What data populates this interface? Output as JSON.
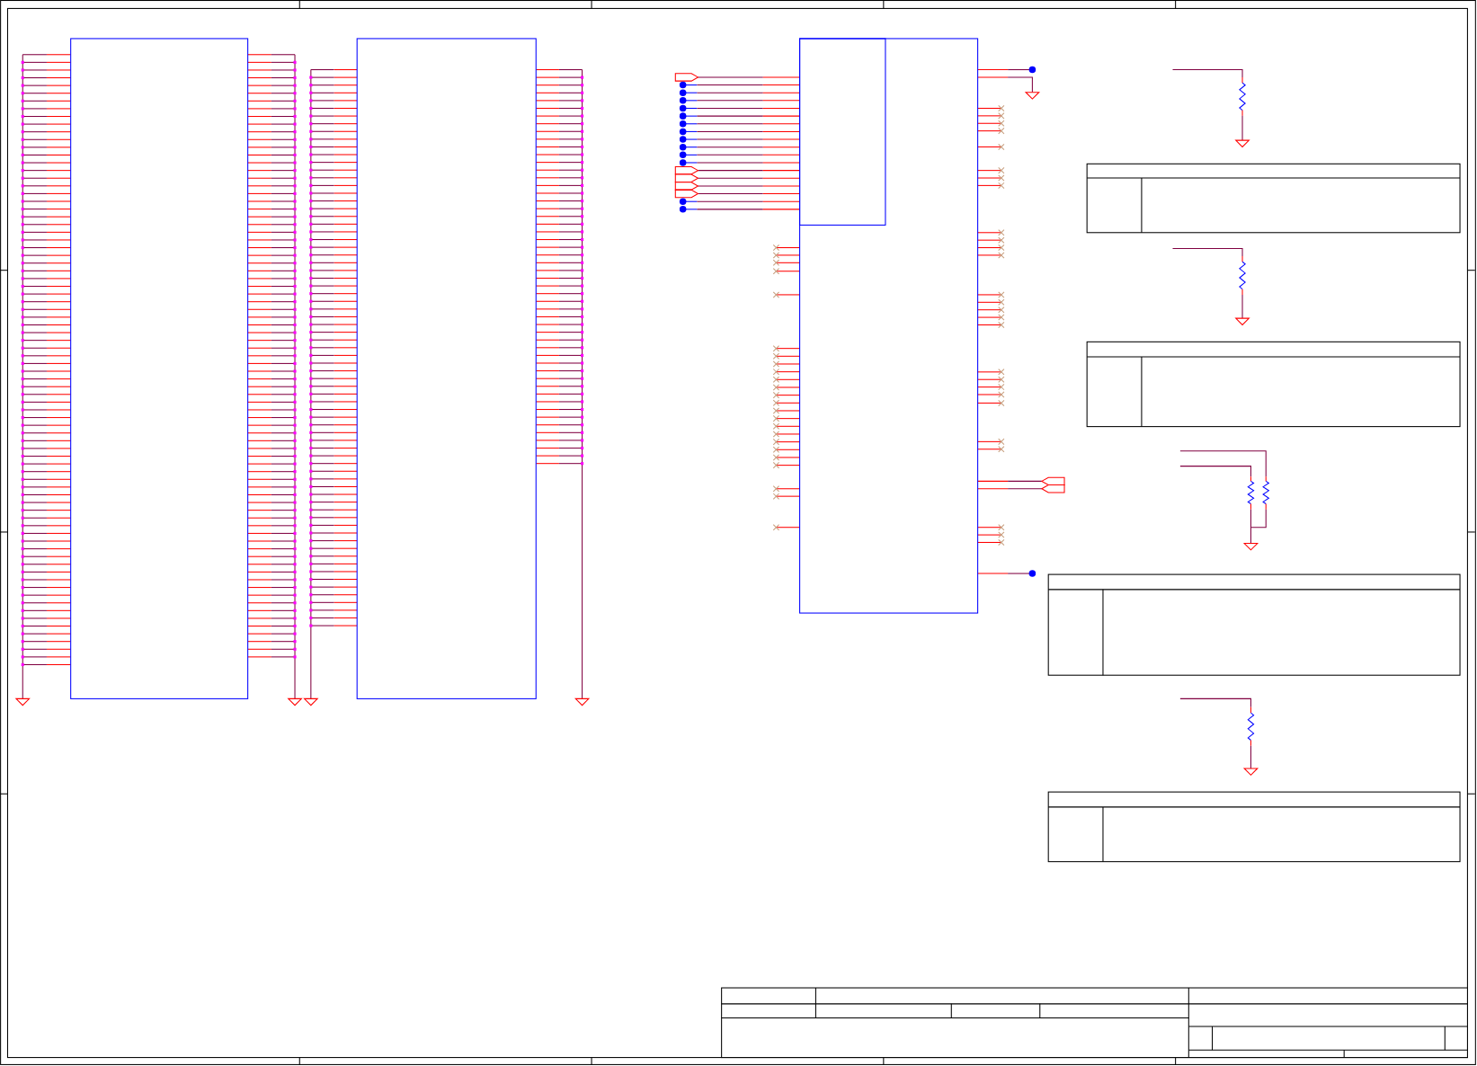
{
  "sheet": {
    "kind": "schematic"
  },
  "connectors": [
    {
      "kind": "header"
    },
    {
      "kind": "header"
    }
  ],
  "chip": {
    "left_pins": [
      {
        "kind": "port"
      },
      {
        "kind": "dot"
      },
      {
        "kind": "dot"
      },
      {
        "kind": "dot"
      },
      {
        "kind": "dot"
      },
      {
        "kind": "dot"
      },
      {
        "kind": "dot"
      },
      {
        "kind": "dot"
      },
      {
        "kind": "dot"
      },
      {
        "kind": "dot"
      },
      {
        "kind": "dot"
      },
      {
        "kind": "dot"
      },
      {
        "kind": "port"
      },
      {
        "kind": "port"
      },
      {
        "kind": "port"
      },
      {
        "kind": "port"
      },
      {
        "kind": "dot"
      },
      {
        "kind": "dot"
      },
      {
        "kind": "open"
      },
      {
        "kind": "open"
      },
      {
        "kind": "open"
      },
      {
        "kind": "open"
      },
      {
        "kind": "open"
      },
      {
        "kind": "open"
      },
      {
        "kind": "open"
      },
      {
        "kind": "open"
      },
      {
        "kind": "open"
      },
      {
        "kind": "open"
      },
      {
        "kind": "open"
      },
      {
        "kind": "open"
      },
      {
        "kind": "open"
      },
      {
        "kind": "open"
      },
      {
        "kind": "open"
      },
      {
        "kind": "open"
      },
      {
        "kind": "open"
      },
      {
        "kind": "open"
      },
      {
        "kind": "open"
      },
      {
        "kind": "open"
      },
      {
        "kind": "open"
      },
      {
        "kind": "open"
      },
      {
        "kind": "open"
      },
      {
        "kind": "open"
      }
    ],
    "right_pins": [
      {
        "kind": "dot"
      },
      {
        "kind": "ground"
      },
      {
        "kind": "open"
      },
      {
        "kind": "open"
      },
      {
        "kind": "open"
      },
      {
        "kind": "open"
      },
      {
        "kind": "open"
      },
      {
        "kind": "open"
      },
      {
        "kind": "open"
      },
      {
        "kind": "open"
      },
      {
        "kind": "open"
      },
      {
        "kind": "open"
      },
      {
        "kind": "open"
      },
      {
        "kind": "open"
      },
      {
        "kind": "open"
      },
      {
        "kind": "open"
      },
      {
        "kind": "open"
      },
      {
        "kind": "open"
      },
      {
        "kind": "open"
      },
      {
        "kind": "open"
      },
      {
        "kind": "open"
      },
      {
        "kind": "open"
      },
      {
        "kind": "open"
      },
      {
        "kind": "open"
      },
      {
        "kind": "open"
      },
      {
        "kind": "open"
      },
      {
        "kind": "port"
      },
      {
        "kind": "port"
      },
      {
        "kind": "open"
      },
      {
        "kind": "open"
      },
      {
        "kind": "open"
      },
      {
        "kind": "dot"
      }
    ]
  },
  "resistors": [
    {
      "kind": "single"
    },
    {
      "kind": "single"
    },
    {
      "kind": "pair"
    },
    {
      "kind": "single"
    }
  ],
  "note_tables": [
    {
      "kind": "note"
    },
    {
      "kind": "note"
    },
    {
      "kind": "note"
    },
    {
      "kind": "note"
    }
  ],
  "title_block": {
    "kind": "standard"
  }
}
